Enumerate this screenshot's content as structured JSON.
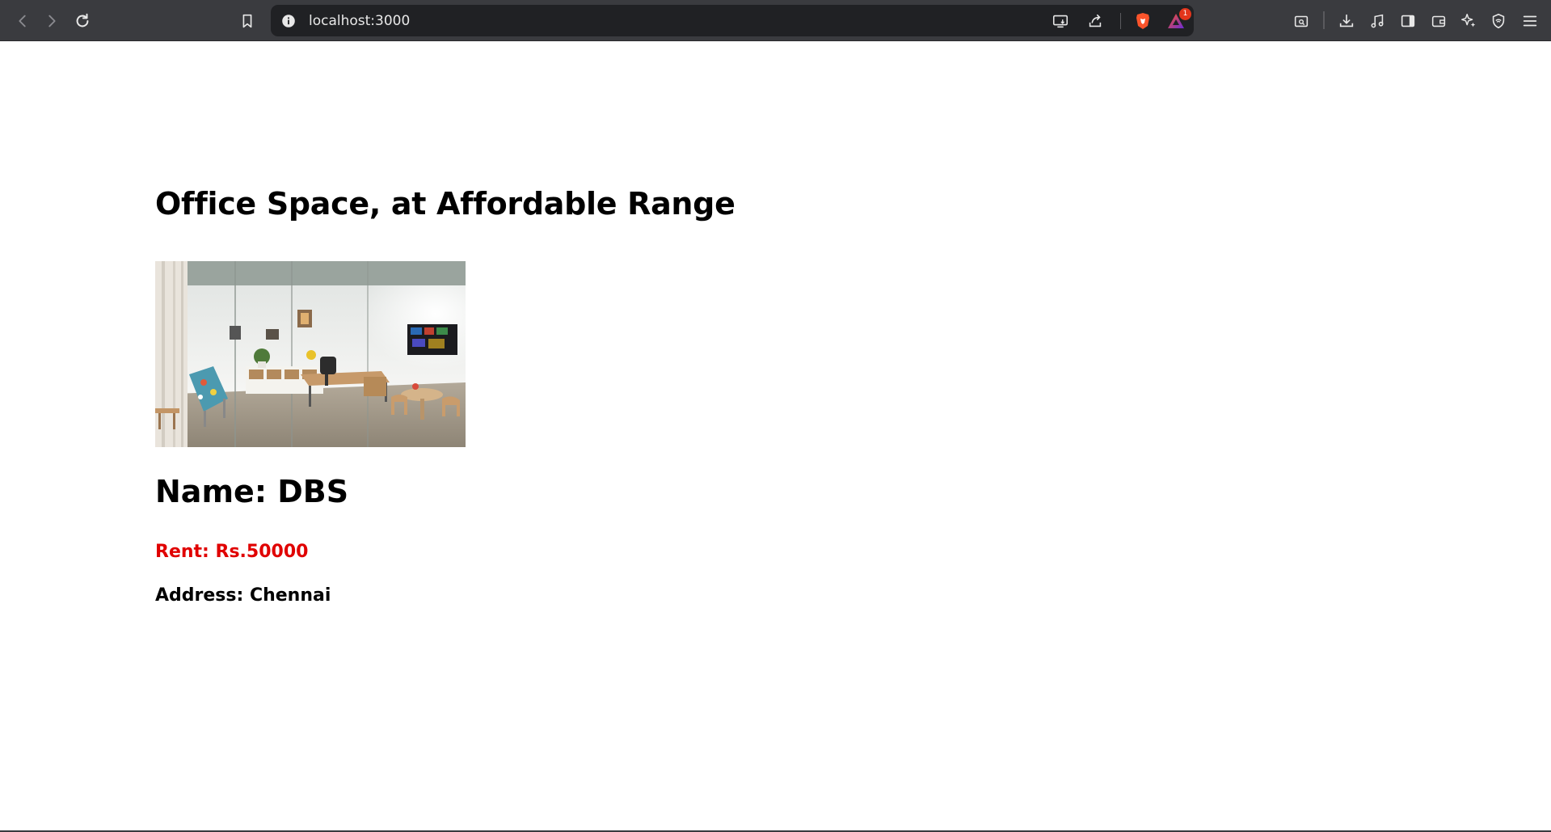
{
  "browser": {
    "url": "localhost:3000",
    "notification_count": "1",
    "colors": {
      "toolbar": "#3a3b3f",
      "address_bar": "#202124",
      "brave_orange": "#fb542b",
      "badge": "#e3351b"
    },
    "icons": [
      "back-icon",
      "forward-icon",
      "reload-icon",
      "bookmark-icon",
      "site-info-icon",
      "install-app-icon",
      "share-icon",
      "brave-shields-icon",
      "brave-rewards-icon",
      "reader-mode-icon",
      "downloads-icon",
      "media-icon",
      "sidebar-icon",
      "wallet-icon",
      "leo-ai-icon",
      "vpn-icon",
      "menu-icon"
    ]
  },
  "page": {
    "title": "Office Space, at Affordable Range",
    "image_subject": "office-room-photo",
    "name_label": "Name: DBS",
    "rent_label": "Rent: Rs.50000",
    "address_label": "Address: Chennai",
    "colors": {
      "rent": "#e00000",
      "text": "#000000",
      "background": "#ffffff"
    }
  }
}
